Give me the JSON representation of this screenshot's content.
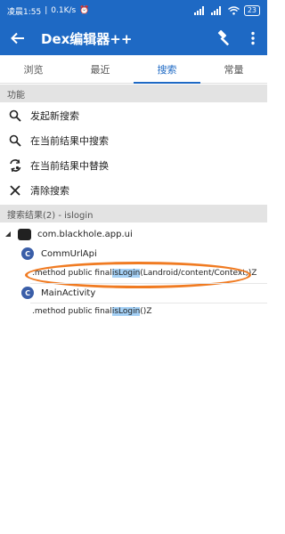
{
  "statusbar": {
    "time": "凌晨1:55",
    "speed": "0.1K/s",
    "battery": "23"
  },
  "appbar": {
    "title": "Dex编辑器++"
  },
  "tabs": [
    "浏览",
    "最近",
    "搜索",
    "常量"
  ],
  "function_header": "功能",
  "menu": [
    {
      "label": "发起新搜索",
      "icon": "search-icon"
    },
    {
      "label": "在当前结果中搜索",
      "icon": "search-icon"
    },
    {
      "label": "在当前结果中替换",
      "icon": "replace-icon"
    },
    {
      "label": "清除搜索",
      "icon": "close-icon"
    }
  ],
  "results_header": "搜索结果(2) - islogin",
  "tree": {
    "package": "com.blackhole.app.ui",
    "class1": "CommUrlApi",
    "method1": {
      "prefix": ".method public final ",
      "match": "isLogin",
      "suffix": "(Landroid/content/Context;)Z"
    },
    "class2": "MainActivity",
    "method2": {
      "prefix": ".method public final ",
      "match": "isLogin",
      "suffix": "()Z"
    }
  },
  "accent_color": "#1e69c4"
}
